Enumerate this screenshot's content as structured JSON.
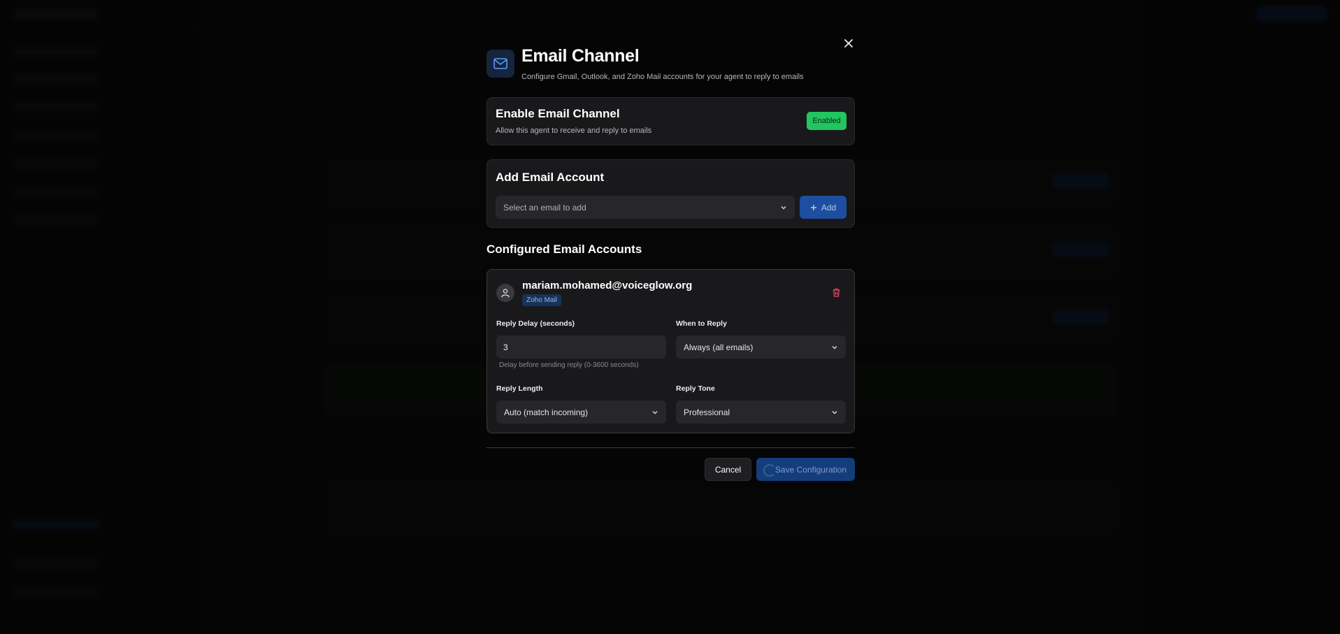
{
  "modal": {
    "title": "Email Channel",
    "subtitle": "Configure Gmail, Outlook, and Zoho Mail accounts for your agent to reply to emails",
    "close_icon": "close-icon",
    "header_icon": "mail-icon"
  },
  "enable_section": {
    "title": "Enable Email Channel",
    "description": "Allow this agent to receive and reply to emails",
    "status_label": "Enabled",
    "status_color": "#22c55e"
  },
  "add_account": {
    "title": "Add Email Account",
    "select_placeholder": "Select an email to add",
    "add_label": "Add",
    "add_icon": "plus-icon"
  },
  "configured": {
    "title": "Configured Email Accounts",
    "accounts": [
      {
        "email": "mariam.mohamed@voiceglow.org",
        "provider": "Zoho Mail",
        "avatar_icon": "user-icon",
        "delete_icon": "trash-icon",
        "reply_delay_label": "Reply Delay (seconds)",
        "reply_delay_value": "3",
        "reply_delay_hint": "Delay before sending reply (0-3600 seconds)",
        "when_to_reply_label": "When to Reply",
        "when_to_reply_value": "Always (all emails)",
        "reply_length_label": "Reply Length",
        "reply_length_value": "Auto (match incoming)",
        "reply_tone_label": "Reply Tone",
        "reply_tone_value": "Professional"
      }
    ]
  },
  "footer": {
    "cancel_label": "Cancel",
    "save_label": "Save Configuration",
    "accent_color": "#1d4ea0"
  }
}
